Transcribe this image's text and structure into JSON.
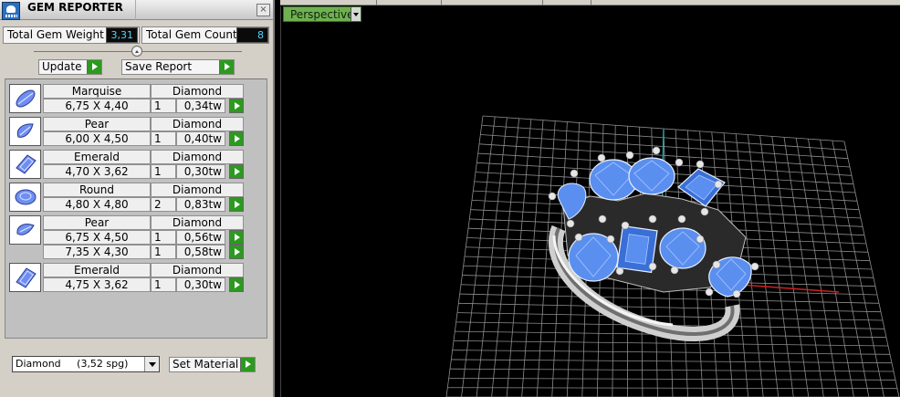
{
  "panel": {
    "title": "GEM REPORTER",
    "close_label": "×"
  },
  "stats": {
    "weight_label": "Total Gem Weight",
    "weight_value": "3,31",
    "count_label": "Total Gem Count",
    "count_value": "8"
  },
  "actions": {
    "update_label": "Update",
    "save_label": "Save Report"
  },
  "gems": [
    {
      "shape": "Marquise",
      "material": "Diamond",
      "icon": "marquise-icon",
      "sizes": [
        {
          "dims": "6,75 X 4,40",
          "count": "1",
          "weight": "0,34tw"
        }
      ]
    },
    {
      "shape": "Pear",
      "material": "Diamond",
      "icon": "pear-icon",
      "sizes": [
        {
          "dims": "6,00 X 4,50",
          "count": "1",
          "weight": "0,40tw"
        }
      ]
    },
    {
      "shape": "Emerald",
      "material": "Diamond",
      "icon": "emerald-icon",
      "sizes": [
        {
          "dims": "4,70 X 3,62",
          "count": "1",
          "weight": "0,30tw"
        }
      ]
    },
    {
      "shape": "Round",
      "material": "Diamond",
      "icon": "round-icon",
      "sizes": [
        {
          "dims": "4,80 X 4,80",
          "count": "2",
          "weight": "0,83tw"
        }
      ]
    },
    {
      "shape": "Pear",
      "material": "Diamond",
      "icon": "pear-icon",
      "sizes": [
        {
          "dims": "6,75 X 4,50",
          "count": "1",
          "weight": "0,56tw"
        },
        {
          "dims": "7,35 X 4,30",
          "count": "1",
          "weight": "0,58tw"
        }
      ]
    },
    {
      "shape": "Emerald",
      "material": "Diamond",
      "icon": "emerald-icon",
      "sizes": [
        {
          "dims": "4,75 X 3,62",
          "count": "1",
          "weight": "0,30tw"
        }
      ]
    }
  ],
  "material": {
    "selected": "Diamond     (3,52 spg)",
    "set_label": "Set Material"
  },
  "viewport": {
    "view_label": "Perspective"
  },
  "colors": {
    "accent_green": "#2c9a1f",
    "value_cyan": "#4fd6ff",
    "gem_blue": "#5a8ff0",
    "axis_red": "#cc2222",
    "axis_teal": "#20a0a0"
  }
}
